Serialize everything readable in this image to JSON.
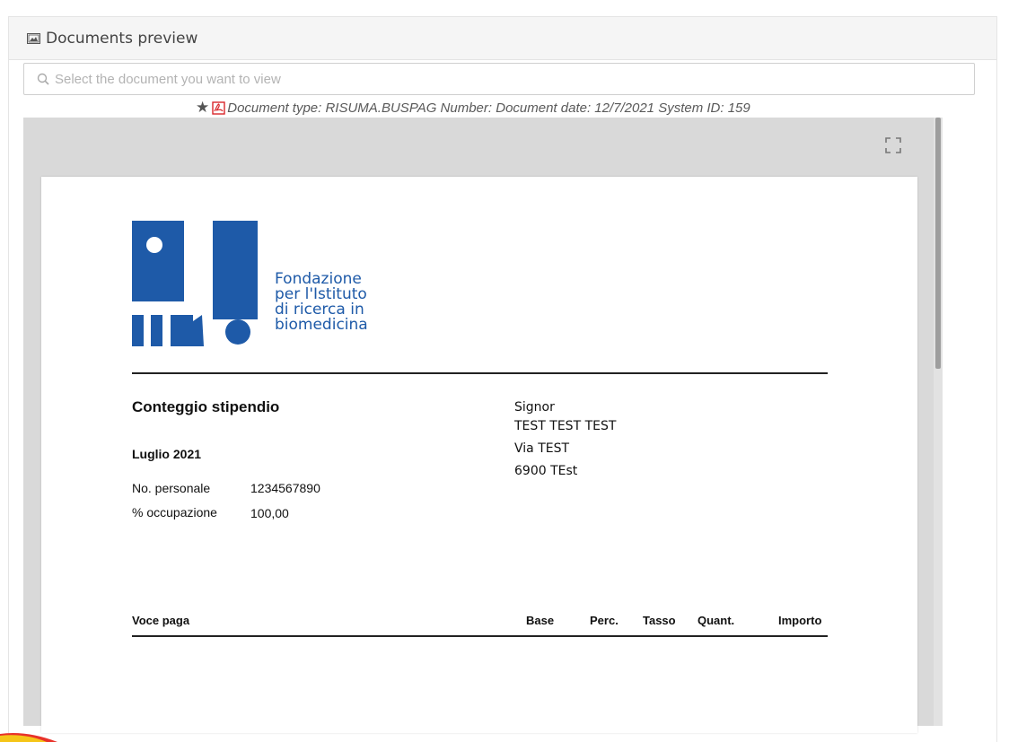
{
  "panel": {
    "title": "Documents preview",
    "icon": "image-icon"
  },
  "search": {
    "placeholder": "Select the document you want to view",
    "value": ""
  },
  "document_info": {
    "text": "Document type: RISUMA.BUSPAG Number: Document date: 12/7/2021 System ID: 159",
    "icons": [
      "star-icon",
      "pdf-icon"
    ]
  },
  "viewer": {
    "fullscreen_icon": "fullscreen-icon"
  },
  "document": {
    "organization": "Fondazione\nper l'Istituto\ndi ricerca in\nbiomedicina",
    "title": "Conteggio stipendio",
    "month": "Luglio 2021",
    "fields": [
      {
        "label": "No. personale",
        "value": "1234567890"
      },
      {
        "label": "% occupazione",
        "value": "100,00"
      }
    ],
    "address": {
      "salutation": "Signor",
      "name": "TEST TEST TEST",
      "street": "Via TEST",
      "city": "6900 TEst"
    },
    "table_headers": [
      "Voce paga",
      "Base",
      "Perc.",
      "Tasso",
      "Quant.",
      "Importo"
    ]
  },
  "colors": {
    "logo_blue": "#1e5aa8",
    "pdf_red": "#d9262b",
    "viewer_bg": "#d9d9d9"
  }
}
